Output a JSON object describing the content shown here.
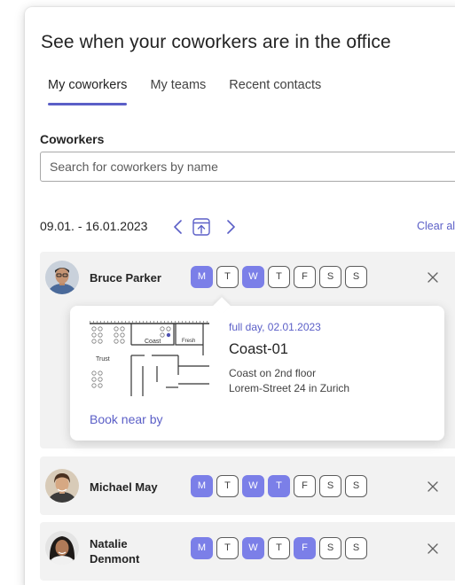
{
  "header": {
    "title": "See when your coworkers are in the office"
  },
  "tabs": [
    {
      "label": "My coworkers",
      "active": true
    },
    {
      "label": "My teams",
      "active": false
    },
    {
      "label": "Recent contacts",
      "active": false
    }
  ],
  "search": {
    "label": "Coworkers",
    "placeholder": "Search for coworkers by name"
  },
  "week": {
    "range": "09.01. - 16.01.2023",
    "prev_icon": "chevron-left-icon",
    "today_icon": "calendar-today-icon",
    "next_icon": "chevron-right-icon",
    "clear_label": "Clear al"
  },
  "day_letters": [
    "M",
    "T",
    "W",
    "T",
    "F",
    "S",
    "S"
  ],
  "coworkers": [
    {
      "name": "Bruce Parker",
      "days_in_office": [
        true,
        false,
        true,
        false,
        false,
        false,
        false
      ]
    },
    {
      "name": "Michael May",
      "days_in_office": [
        true,
        false,
        true,
        true,
        false,
        false,
        false
      ]
    },
    {
      "name_line1": "Natalie",
      "name_line2": "Denmont",
      "days_in_office": [
        true,
        false,
        true,
        false,
        true,
        false,
        false
      ]
    }
  ],
  "booking": {
    "when": "full day, 02.01.2023",
    "desk": "Coast-01",
    "location_line1": "Coast on 2nd floor",
    "location_line2": "Lorem-Street 24 in Zurich",
    "book_label": "Book near by",
    "map_labels": {
      "coast": "Coast",
      "fresh": "Fresh",
      "trust": "Trust"
    }
  },
  "colors": {
    "accent": "#5b5fc7",
    "day_on": "#7b7fe8",
    "card_bg": "#f2f2f2"
  }
}
